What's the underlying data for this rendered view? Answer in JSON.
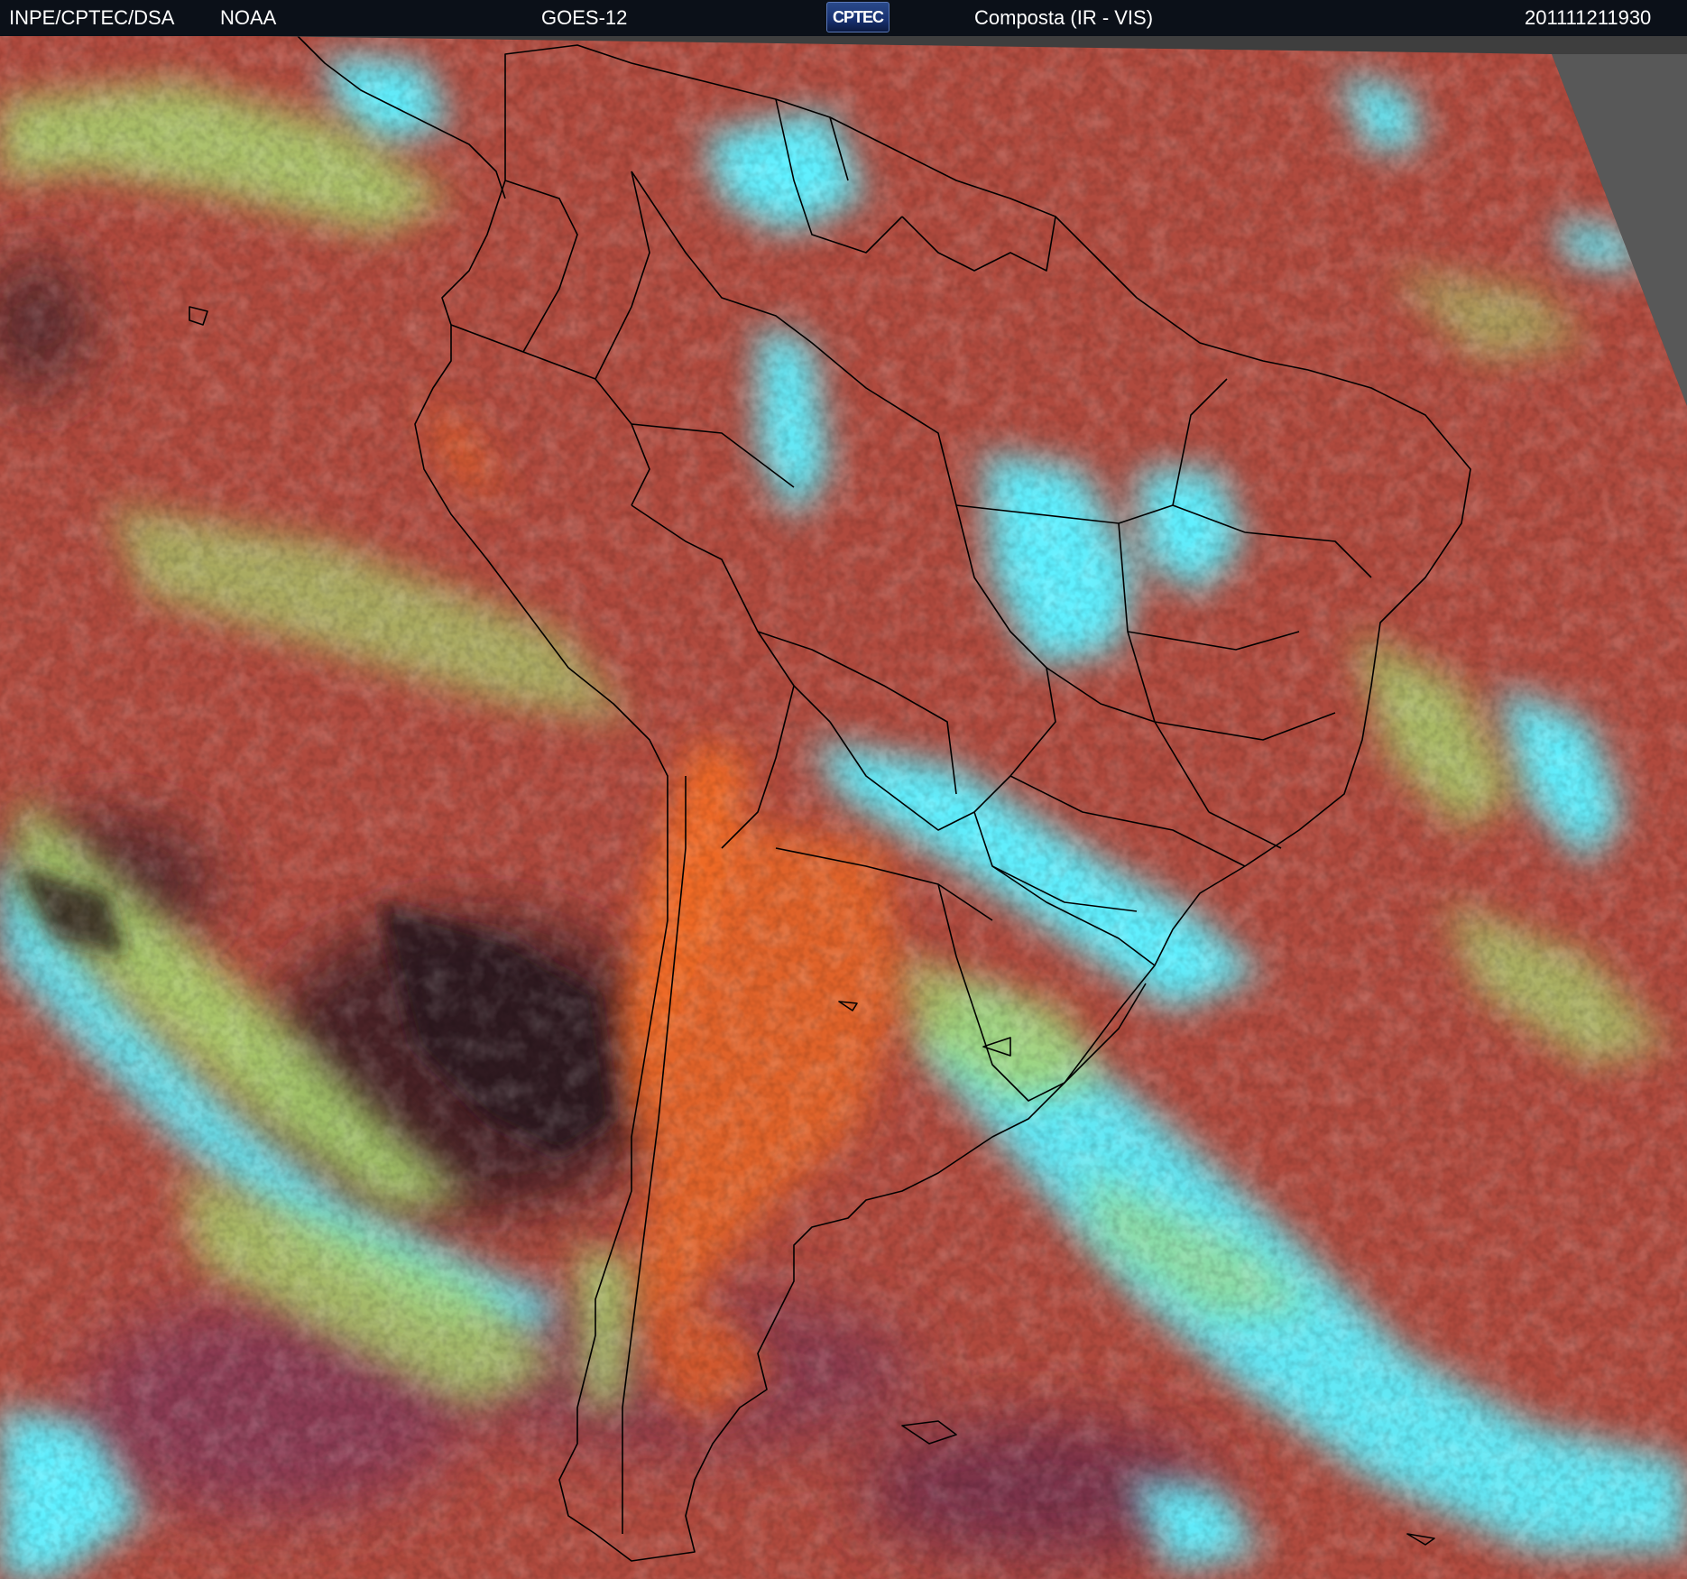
{
  "header": {
    "source": "INPE/CPTEC/DSA",
    "agency": "NOAA",
    "satellite": "GOES-12",
    "logo_text": "CPTEC",
    "product": "Composta (IR - VIS)",
    "timestamp": "201111211930"
  },
  "image": {
    "subject": "GOES-12 composite IR-VIS satellite image of South America",
    "colors": {
      "clear_land_ocean": "#b4503c",
      "warm_land": "#e0642a",
      "dark_ocean": "#3a1e22",
      "high_cloud": "#5ef0ff",
      "mid_cloud": "#a8d870",
      "outside_scan": "#404040",
      "borders": "#000000"
    }
  }
}
